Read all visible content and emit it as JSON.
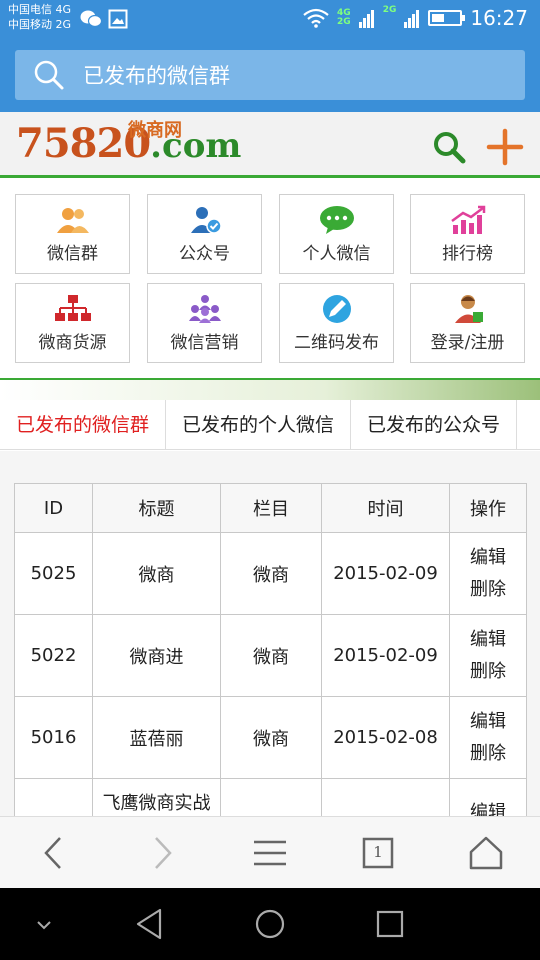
{
  "status_bar": {
    "carrier1": "中国电信 4G",
    "carrier2": "中国移动 2G",
    "time": "16:27",
    "net_badge1": "4G",
    "net_badge2": "2G",
    "net_badge3": "2G",
    "battery_level": 0.4
  },
  "search": {
    "label": "已发布的微信群"
  },
  "logo": {
    "number": "75820",
    "domain": ".com",
    "chinese": "微商网"
  },
  "tiles": [
    {
      "label": "微信群",
      "icon": "group-icon"
    },
    {
      "label": "公众号",
      "icon": "official-account-icon"
    },
    {
      "label": "个人微信",
      "icon": "chat-bubble-icon"
    },
    {
      "label": "排行榜",
      "icon": "ranking-chart-icon"
    },
    {
      "label": "微商货源",
      "icon": "supply-tree-icon"
    },
    {
      "label": "微信营销",
      "icon": "marketing-people-icon"
    },
    {
      "label": "二维码发布",
      "icon": "pen-icon"
    },
    {
      "label": "登录/注册",
      "icon": "user-login-icon"
    }
  ],
  "tabs": [
    {
      "label": "已发布的微信群",
      "active": true
    },
    {
      "label": "已发布的个人微信",
      "active": false
    },
    {
      "label": "已发布的公众号",
      "active": false
    }
  ],
  "table": {
    "headers": [
      "ID",
      "标题",
      "栏目",
      "时间",
      "操作"
    ],
    "rows": [
      {
        "id": "5025",
        "title": "微商",
        "category": "微商",
        "time": "2015-02-09",
        "edit": "编辑",
        "delete": "删除"
      },
      {
        "id": "5022",
        "title": "微商进",
        "category": "微商",
        "time": "2015-02-09",
        "edit": "编辑",
        "delete": "删除"
      },
      {
        "id": "5016",
        "title": "蓝蓓丽",
        "category": "微商",
        "time": "2015-02-08",
        "edit": "编辑",
        "delete": "删除"
      },
      {
        "id": "",
        "title": "飞鹰微商实战",
        "category": "",
        "time": "",
        "edit": "编辑",
        "delete": ""
      }
    ]
  },
  "browser_bar": {
    "tab_count": "1"
  },
  "colors": {
    "header_blue": "#3a8fd8",
    "accent_green": "#3aa935",
    "active_tab_red": "#e02020"
  }
}
